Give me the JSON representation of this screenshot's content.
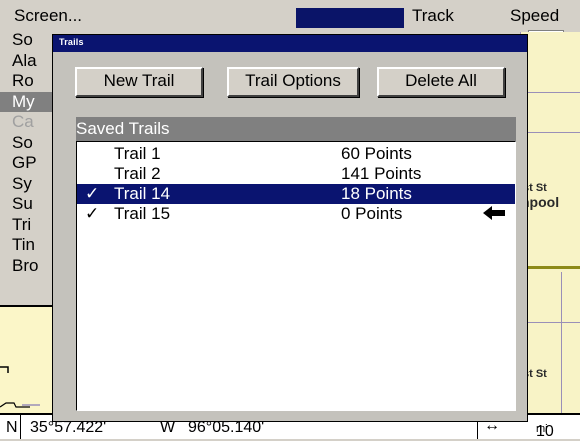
{
  "app": {
    "screen_label": "Screen...",
    "track_label": "Track",
    "speed_label": "Speed"
  },
  "side_menu": {
    "items": [
      "So",
      "Ala",
      "Ro",
      "My",
      "Ca",
      "So",
      "GP",
      "Sy",
      "Su",
      "Tri",
      "Tin",
      "Bro"
    ],
    "highlighted_index": 3,
    "dim_index": 4
  },
  "map": {
    "labels": [
      "st St",
      "npool",
      "st St"
    ],
    "scale_value": "10",
    "scale_unit": "mi"
  },
  "status": {
    "lat_hemisphere": "N",
    "lat": "35°57.422'",
    "lon_hemisphere": "W",
    "lon": "96°05.140'",
    "scale_icon": "↔"
  },
  "dialog": {
    "title": "Trails",
    "buttons": {
      "new_trail": "New Trail",
      "trail_options": "Trail Options",
      "delete_all": "Delete All"
    },
    "list_header": "Saved Trails",
    "trails": [
      {
        "name": "Trail 1",
        "points": "60 Points",
        "check": "",
        "selected": false,
        "active": false
      },
      {
        "name": "Trail 2",
        "points": "141 Points",
        "check": "",
        "selected": false,
        "active": false
      },
      {
        "name": "Trail 14",
        "points": "18 Points",
        "check": "✓",
        "selected": true,
        "active": false
      },
      {
        "name": "Trail 15",
        "points": "0 Points",
        "check": "✓",
        "selected": false,
        "active": true
      }
    ]
  },
  "colors": {
    "title_bar": "#0a1470",
    "selection": "#0a1470",
    "dialog_bg": "#c4c2bc",
    "list_header": "#808080",
    "map_bg": "#f8f3c6"
  }
}
